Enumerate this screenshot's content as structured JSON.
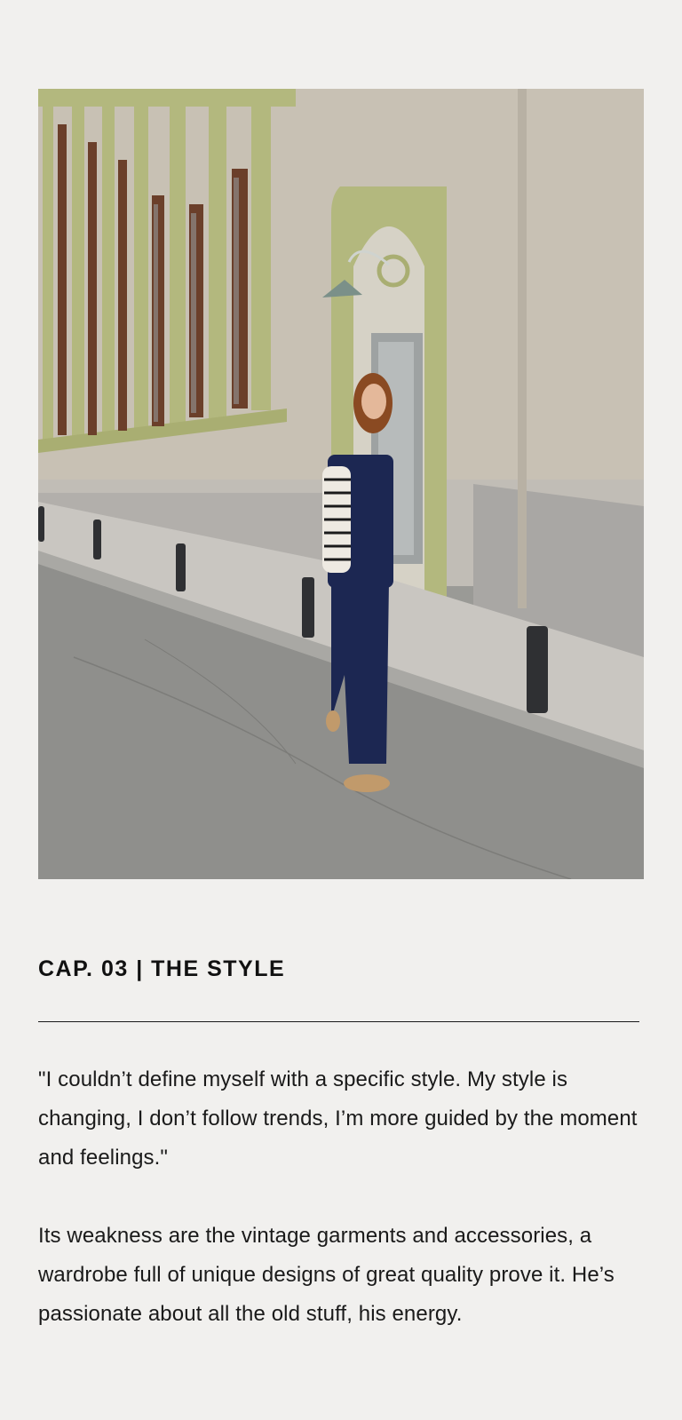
{
  "photo": {
    "alt_description": "Woman in navy vest and trousers with striped top standing on a street beside a building with green window frames",
    "colors": {
      "wall": "#c8c1b4",
      "trim": "#b3b87e",
      "window": "#6b3f2a",
      "sidewalk": "#c9c6c1",
      "road": "#8f8f8c",
      "plinth": "#a9a7a4",
      "bollard": "#2f3033",
      "navy": "#1c2752",
      "shoes": "#c19a6b",
      "hair": "#8a4a22",
      "lamp": "#7b9089"
    }
  },
  "article": {
    "chapter_title": "CAP. 03 | THE STYLE",
    "quote": "\"I couldn’t define myself with a specific style. My style is changing, I don’t follow trends, I’m more guided by the moment and feelings.\"",
    "body": "Its weakness are the vintage garments and accessories, a wardrobe full of unique designs of great quality prove it. He’s passionate about all the old stuff, his energy."
  }
}
